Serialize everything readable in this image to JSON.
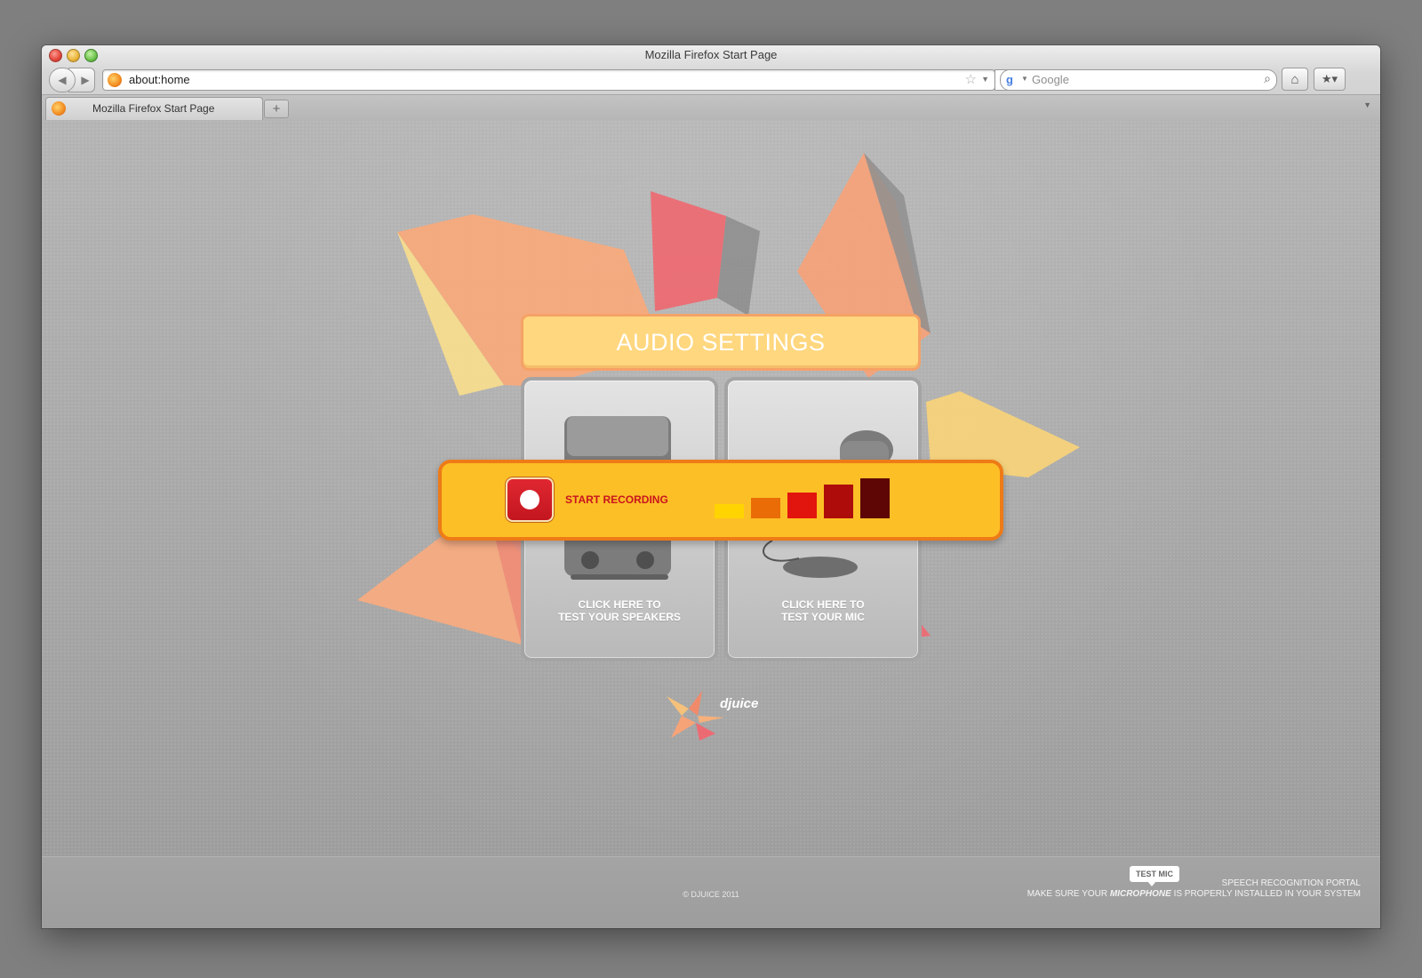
{
  "window": {
    "title": "Mozilla Firefox Start Page"
  },
  "toolbar": {
    "back_icon": "back-arrow-icon",
    "forward_icon": "forward-arrow-icon",
    "url": "about:home",
    "reload_icon": "reload-icon",
    "search_placeholder": "Google",
    "search_engine_icon": "google-icon",
    "home_icon": "home-icon",
    "bookmarks_icon": "bookmarks-icon"
  },
  "tabs": [
    {
      "label": "Mozilla Firefox Start Page",
      "active": true
    }
  ],
  "page": {
    "header": "AUDIO SETTINGS",
    "speakers_card": {
      "line1": "CLICK HERE TO",
      "line2": "TEST YOUR SPEAKERS"
    },
    "mic_card": {
      "line1": "CLICK HERE TO",
      "line2": "TEST YOUR MIC"
    },
    "recording": {
      "label": "START RECORDING",
      "level_colors": [
        "#ffd400",
        "#e96c07",
        "#e2140e",
        "#ad0c0a",
        "#5e0505"
      ],
      "level_heights": [
        0.35,
        0.5,
        0.65,
        0.85,
        1.0
      ]
    },
    "logo_text": "djuice"
  },
  "footer": {
    "copyright": "© DJUICE 2011",
    "test_mic": "TEST MIC",
    "portal": "SPEECH RECOGNITION PORTAL",
    "note_prefix": "MAKE SURE YOUR",
    "note_emphasis": "MICROPHONE",
    "note_suffix": "IS PROPERLY INSTALLED IN YOUR SYSTEM"
  },
  "colors": {
    "header_fill": "#ffd77f",
    "header_border": "#f5a266",
    "panel_fill": "#fdbf26",
    "panel_border": "#ee7b17",
    "record_red": "#d51d27"
  }
}
